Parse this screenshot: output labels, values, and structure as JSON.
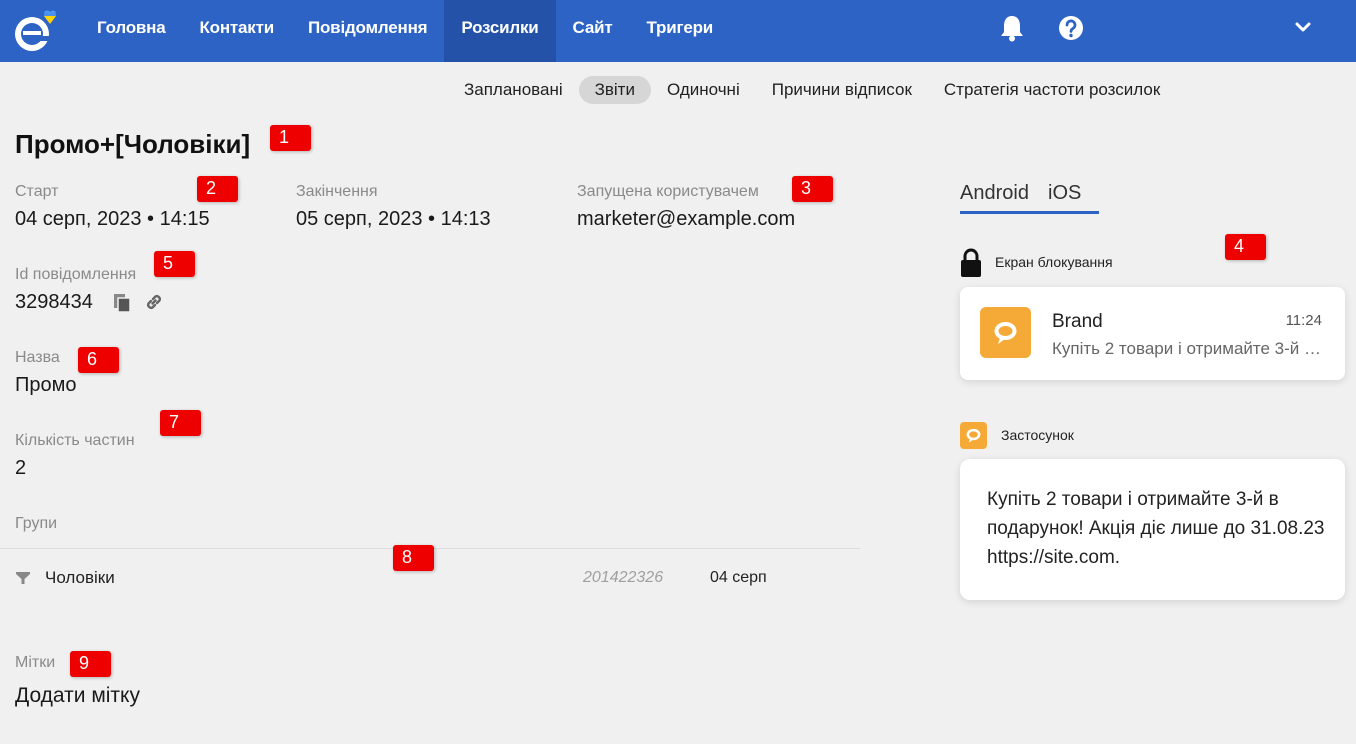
{
  "nav": {
    "items": [
      {
        "label": "Головна"
      },
      {
        "label": "Контакти"
      },
      {
        "label": "Повідомлення"
      },
      {
        "label": "Розсилки"
      },
      {
        "label": "Сайт"
      },
      {
        "label": "Тригери"
      }
    ],
    "active_index": 3
  },
  "subtabs": [
    {
      "label": "Заплановані"
    },
    {
      "label": "Звіти"
    },
    {
      "label": "Одиночні"
    },
    {
      "label": "Причини відписок"
    },
    {
      "label": "Стратегія частоти розсилок"
    }
  ],
  "campaign": {
    "title": "Промо+[Чоловіки]",
    "start_label": "Старт",
    "start_value": "04 серп, 2023 • 14:15",
    "end_label": "Закінчення",
    "end_value": "05 серп, 2023 • 14:13",
    "launched_label": "Запущена користувачем",
    "launched_value": "marketer@example.com",
    "message_id_label": "Id повідомлення",
    "message_id_value": "3298434",
    "name_label": "Назва",
    "name_value": "Промо",
    "parts_label": "Кількість частин",
    "parts_value": "2",
    "groups_label": "Групи",
    "groups": [
      {
        "name": "Чоловіки",
        "id": "201422326",
        "date": "04 серп"
      }
    ],
    "tags_label": "Мітки",
    "add_tag_label": "Додати мітку"
  },
  "annotations": [
    "1",
    "2",
    "3",
    "4",
    "5",
    "6",
    "7",
    "8",
    "9"
  ],
  "preview": {
    "tabs": [
      {
        "label": "Android"
      },
      {
        "label": "iOS"
      }
    ],
    "lock_screen_label": "Екран блокування",
    "brand": "Brand",
    "time": "11:24",
    "short_text": "Купіть 2 товари і отримайте 3-й в подарунок! Акція діє лише до 31.08.23 https://site.com.",
    "app_label": "Застосунок",
    "full_text": "Купіть 2 товари і отримайте 3-й в подарунок! Акція діє лише до 31.08.23 https://site.com."
  },
  "colors": {
    "header": "#2c63c5",
    "header_active": "#2452a9",
    "accent_orange": "#f5a936",
    "annotation_red": "#ee0000"
  }
}
